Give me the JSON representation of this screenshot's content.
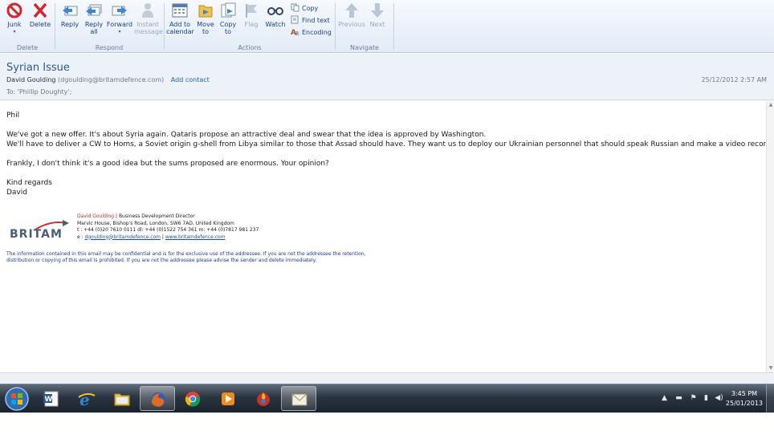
{
  "ribbon": {
    "delete_group": {
      "label": "Delete",
      "junk": "Junk",
      "delete": "Delete"
    },
    "respond_group": {
      "label": "Respond",
      "reply": "Reply",
      "reply_all": [
        "Reply",
        "all"
      ],
      "forward": "Forward",
      "instant_message": [
        "Instant",
        "message"
      ]
    },
    "actions_group": {
      "label": "Actions",
      "add_to_calendar": [
        "Add to",
        "calendar"
      ],
      "move_to": [
        "Move",
        "to"
      ],
      "copy_to": [
        "Copy",
        "to"
      ],
      "flag": "Flag",
      "watch": "Watch",
      "copy": "Copy",
      "find_text": "Find text",
      "encoding": "Encoding"
    },
    "navigate_group": {
      "label": "Navigate",
      "previous": "Previous",
      "next": "Next"
    }
  },
  "message": {
    "subject": "Syrian Issue",
    "from_name": "David Goulding",
    "from_email": "(dgoulding@britamdefence.com)",
    "add_contact": "Add contact",
    "date": "25/12/2012 2:57 AM",
    "to": "To:  'Phillip Doughty';"
  },
  "body": {
    "greeting": "Phil",
    "para1_line1": "We've got a new offer.  It's about Syria again. Qataris propose an attractive deal and swear that the idea is approved by Washington.",
    "para1_line2": "We'll have to deliver a CW to Homs, a Soviet origin g-shell from Libya similar to those that Assad should have. They want us to deploy our Ukrainian personnel that should speak Russian and make a video record.",
    "para2": "Frankly, I don't think it's a good idea but the sums proposed are enormous.  Your opinion?",
    "closing": "Kind regards",
    "signoff": "David"
  },
  "signature": {
    "logo_text": "BRITAM",
    "name": "David Goulding",
    "title": " | Business Development Director",
    "address": "Marvic House, Bishop's Road, London, SW6 7AD, United Kingdom",
    "phones": "t :  +44 (0)20 7610 0111    dl: +44 (0)1522 754 361    m: +44 (0)7817 981 237",
    "email_prefix": "e : ",
    "email": "dgoulding@britamdefence.com",
    "divider": " | ",
    "website": "www.britamdefence.com"
  },
  "disclaimer": "The information contained in this email may be confidential and is for the exclusive use of the addressee. If you are not the addressee the retention, distribution or copying of this email is prohibited. If you are not the addressee please advise the sender and delete immediately.",
  "taskbar": {
    "time": "3:45 PM",
    "date": "25/01/2013"
  },
  "colors": {
    "accent": "#2a5a96",
    "link": "#1e63b6",
    "sig_red": "#b52b2b",
    "taskbar": "#2a3440"
  }
}
